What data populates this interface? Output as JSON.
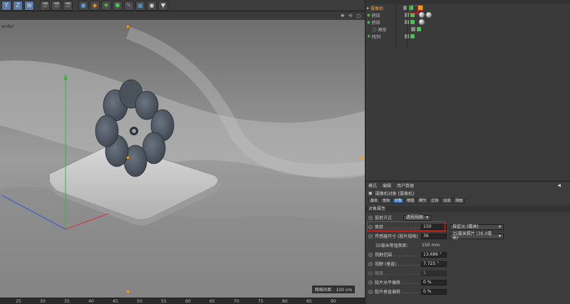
{
  "toolbar": {
    "buttons": [
      "Y",
      "Z",
      "⊞",
      "🎬",
      "🎬",
      "🎬",
      "◼",
      "◆",
      "✚",
      "⬢",
      "✎",
      "▦",
      "◉",
      "▼"
    ]
  },
  "viewport": {
    "label": "ender",
    "scale_badge": "网格间距 : 100 cm",
    "ruler_ticks": [
      "25",
      "30",
      "35",
      "40",
      "45",
      "50",
      "55",
      "60",
      "65",
      "70",
      "75",
      "80",
      "85",
      "90"
    ]
  },
  "object_manager": {
    "rows": [
      {
        "name": "摄像机",
        "selected": true,
        "tags": [
          "target"
        ]
      },
      {
        "name": "挤压",
        "selected": false,
        "tags": [
          "sphere",
          "sphere"
        ]
      },
      {
        "name": "挤压",
        "selected": false,
        "tags": [
          "sphere"
        ]
      },
      {
        "name": "矩形",
        "selected": false,
        "tags": []
      },
      {
        "name": "阵列",
        "selected": false,
        "tags": []
      }
    ]
  },
  "attributes": {
    "menu": [
      "模式",
      "编辑",
      "用户数据"
    ],
    "title": "摄像机对象 [摄像机]",
    "tabs": [
      "基本",
      "坐标",
      "对象",
      "物理",
      "细节",
      "立体",
      "合成",
      "球面"
    ],
    "active_tab": "对象",
    "section": "对象属性",
    "projection": {
      "label": "投射方式",
      "value": "透视视图"
    },
    "focal": {
      "label": "焦距 . . . . . . . . . . . . .",
      "value": "150",
      "dropdown": "自定义 (毫米)"
    },
    "sensor": {
      "label": "传感器尺寸 (胶片规格)",
      "value": "36",
      "dropdown": "35毫米照片 (36.0毫米)"
    },
    "equiv": {
      "label": "35毫米等值焦距:",
      "value": "150 mm"
    },
    "fov": {
      "label": "视野范围 . . . . . . . . .",
      "value": "13.686 °"
    },
    "fov_v": {
      "label": "视野 (垂直) . . . . . . . .",
      "value": "7.725 °"
    },
    "zoom": {
      "label": "缩放 . . . . . . . . . . . . .",
      "value": "1"
    },
    "shift_h": {
      "label": "胶片水平偏移 . . . . . . .",
      "value": "0 %"
    },
    "shift_v": {
      "label": "胶片垂直偏移 . . . . . . .",
      "value": "0 %"
    }
  }
}
